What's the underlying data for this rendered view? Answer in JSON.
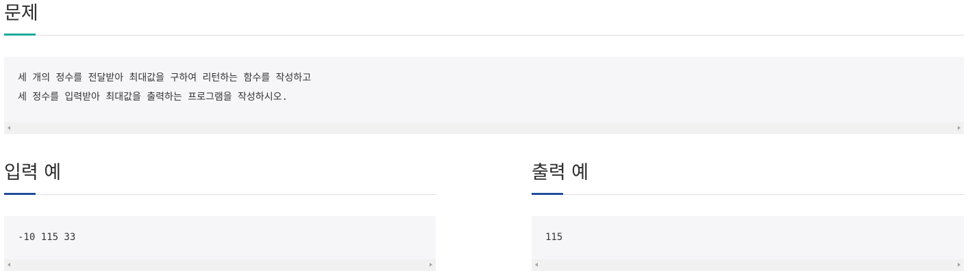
{
  "problem": {
    "title": "문제",
    "lines": [
      "세 개의 정수를 전달받아 최대값을 구하여 리턴하는 함수를 작성하고",
      "세 정수를 입력받아 최대값을 출력하는 프로그램을 작성하시오."
    ]
  },
  "input_example": {
    "title": "입력 예",
    "text": "-10 115 33"
  },
  "output_example": {
    "title": "출력 예",
    "text": "115"
  },
  "colors": {
    "problem_accent": "#1aa99a",
    "example_accent": "#1f4e9c",
    "code_bg": "#f6f6f8",
    "scrollbar_bg": "#f1f1f1"
  },
  "icons": [
    "scroll-left-arrow-icon",
    "scroll-right-arrow-icon"
  ]
}
